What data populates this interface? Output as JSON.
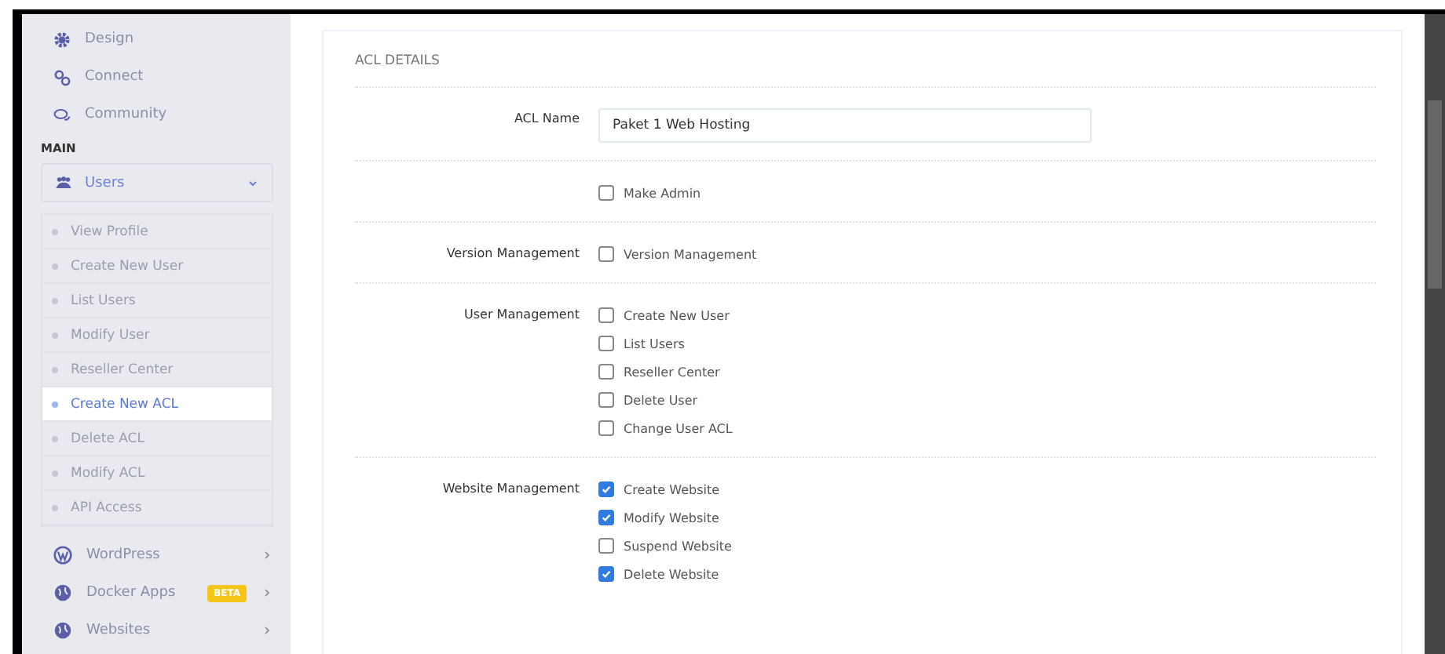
{
  "sidebar": {
    "top_items": [
      {
        "label": "Design",
        "kind": "gear"
      },
      {
        "label": "Connect",
        "kind": "link"
      },
      {
        "label": "Community",
        "kind": "chat"
      }
    ],
    "section_label": "MAIN",
    "users_menu": {
      "label": "Users",
      "expanded": true,
      "items": [
        {
          "label": "View Profile",
          "selected": false
        },
        {
          "label": "Create New User",
          "selected": false
        },
        {
          "label": "List Users",
          "selected": false
        },
        {
          "label": "Modify User",
          "selected": false
        },
        {
          "label": "Reseller Center",
          "selected": false
        },
        {
          "label": "Create New ACL",
          "selected": true
        },
        {
          "label": "Delete ACL",
          "selected": false
        },
        {
          "label": "Modify ACL",
          "selected": false
        },
        {
          "label": "API Access",
          "selected": false
        }
      ]
    },
    "bottom_items": [
      {
        "label": "WordPress",
        "kind": "wp"
      },
      {
        "label": "Docker Apps",
        "kind": "globe",
        "badge": "BETA"
      },
      {
        "label": "Websites",
        "kind": "globe"
      }
    ]
  },
  "form": {
    "title": "ACL DETAILS",
    "rows": [
      {
        "kind": "text",
        "label": "ACL Name",
        "value": "Paket 1 Web Hosting"
      },
      {
        "kind": "checks",
        "options": [
          {
            "label": "Make Admin",
            "checked": false
          }
        ]
      },
      {
        "kind": "checks",
        "label": "Version Management",
        "options": [
          {
            "label": "Version Management",
            "checked": false
          }
        ]
      },
      {
        "kind": "checks",
        "label": "User Management",
        "options": [
          {
            "label": "Create New User",
            "checked": false
          },
          {
            "label": "List Users",
            "checked": false
          },
          {
            "label": "Reseller Center",
            "checked": false
          },
          {
            "label": "Delete User",
            "checked": false
          },
          {
            "label": "Change User ACL",
            "checked": false
          }
        ]
      },
      {
        "kind": "checks",
        "label": "Website Management",
        "options": [
          {
            "label": "Create Website",
            "checked": true
          },
          {
            "label": "Modify Website",
            "checked": true
          },
          {
            "label": "Suspend Website",
            "checked": false
          },
          {
            "label": "Delete Website",
            "checked": true
          }
        ]
      }
    ]
  }
}
